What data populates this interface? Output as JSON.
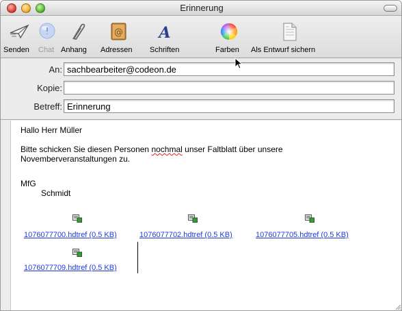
{
  "window": {
    "title": "Erinnerung"
  },
  "toolbar": {
    "items": [
      {
        "label": "Senden",
        "icon": "send-icon",
        "enabled": true
      },
      {
        "label": "Chat",
        "icon": "chat-icon",
        "enabled": false
      },
      {
        "label": "Anhang",
        "icon": "paperclip-icon",
        "enabled": true
      },
      {
        "label": "Adressen",
        "icon": "address-book-icon",
        "enabled": true
      },
      {
        "label": "Schriften",
        "icon": "fonts-icon",
        "enabled": true
      },
      {
        "label": "Farben",
        "icon": "color-wheel-icon",
        "enabled": true
      },
      {
        "label": "Als Entwurf sichern",
        "icon": "save-draft-icon",
        "enabled": true
      }
    ]
  },
  "headers": {
    "to_label": "An:",
    "to_value": "sachbearbeiter@codeon.de",
    "cc_label": "Kopie:",
    "cc_value": "",
    "subject_label": "Betreff:",
    "subject_value": "Erinnerung"
  },
  "message": {
    "greeting": "Hallo Herr Müller",
    "line1_before": "Bitte schicken Sie diesen Personen ",
    "line1_misspelled": "nochmal",
    "line1_after": " unser Faltblatt über unsere",
    "line2": "Novemberveranstaltungen zu.",
    "closing": "MfG",
    "signature": "Schmidt"
  },
  "attachments": [
    {
      "name": "1076077700.hdtref (0.5 KB)",
      "icon": "file-attachment-icon"
    },
    {
      "name": "1076077702.hdtref (0.5 KB)",
      "icon": "file-attachment-icon"
    },
    {
      "name": "1076077705.hdtref (0.5 KB)",
      "icon": "file-attachment-icon"
    },
    {
      "name": "1076077709.hdtref (0.5 KB)",
      "icon": "file-attachment-icon"
    }
  ],
  "colors": {
    "link": "#1f3ad8",
    "spellcheck": "#e02020"
  }
}
